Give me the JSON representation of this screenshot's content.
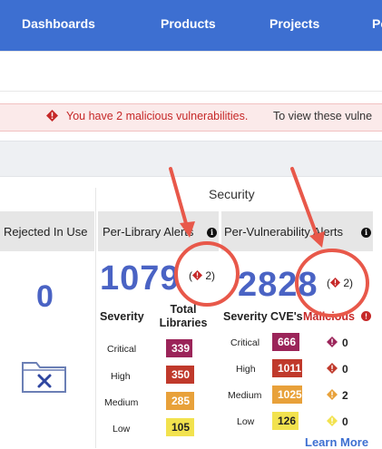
{
  "nav": {
    "items": [
      "Dashboards",
      "Products",
      "Projects",
      "Po"
    ]
  },
  "banner": {
    "message": "You have 2 malicious vulnerabilities.",
    "message_tail": "To view these vulne"
  },
  "left_column": {
    "header": "Rejected In Use",
    "value": "0",
    "icon": "folder-x-icon"
  },
  "security": {
    "title": "Security",
    "per_library": {
      "header": "Per-Library Alerts",
      "total": "1079",
      "malicious_count": "2",
      "severity_label": "Severity",
      "count_label": "Total Libraries",
      "rows": [
        {
          "severity": "Critical",
          "count": "339",
          "color": "#9b2459"
        },
        {
          "severity": "High",
          "count": "350",
          "color": "#c0392b"
        },
        {
          "severity": "Medium",
          "count": "285",
          "color": "#e8a13a"
        },
        {
          "severity": "Low",
          "count": "105",
          "color": "#f2e24e"
        }
      ]
    },
    "per_vulnerability": {
      "header": "Per-Vulnerability Alerts",
      "total": "2828",
      "malicious_count": "2",
      "severity_label": "Severity",
      "count_label": "CVE's",
      "malicious_label": "Malicious",
      "rows": [
        {
          "severity": "Critical",
          "count": "666",
          "malicious": "0",
          "color": "#9b2459"
        },
        {
          "severity": "High",
          "count": "1011",
          "malicious": "0",
          "color": "#c0392b"
        },
        {
          "severity": "Medium",
          "count": "1025",
          "malicious": "2",
          "color": "#e8a13a"
        },
        {
          "severity": "Low",
          "count": "126",
          "malicious": "0",
          "color": "#f2e24e"
        }
      ]
    },
    "learn_more": "Learn More"
  },
  "colors": {
    "nav": "#3d6fd1",
    "accent_number": "#4a63c4",
    "alert_red": "#c62828",
    "annotation": "#e8584a"
  }
}
